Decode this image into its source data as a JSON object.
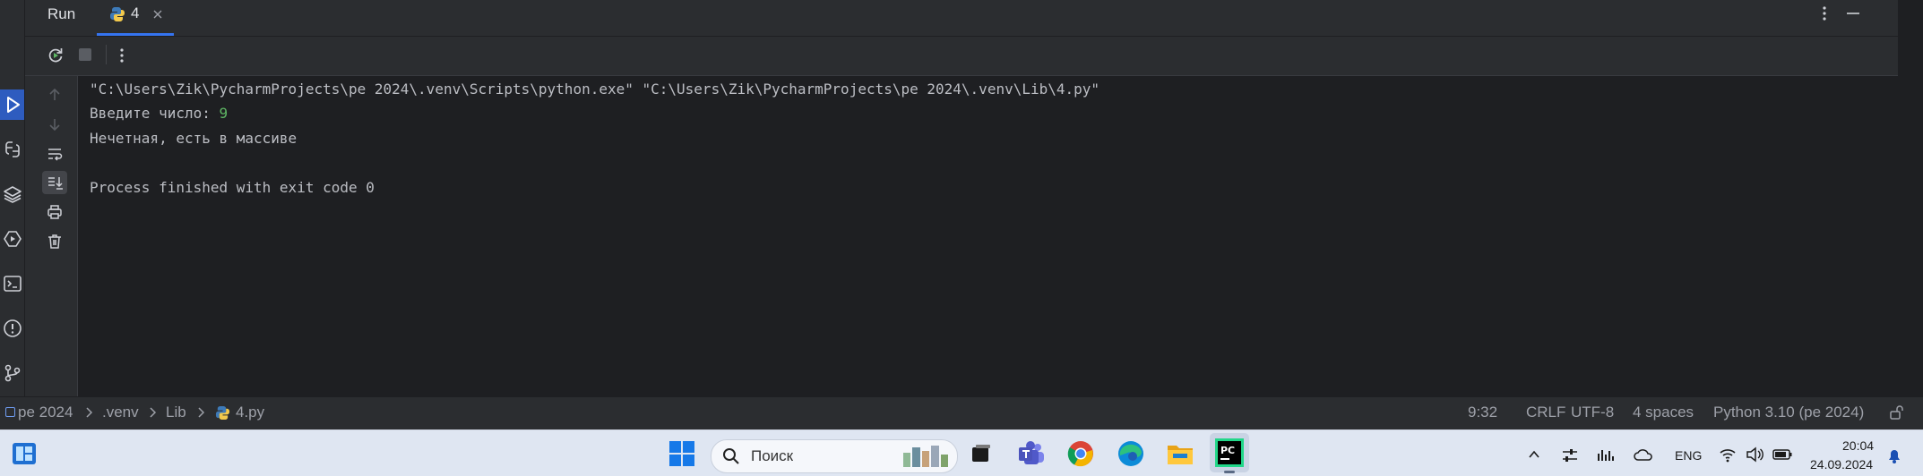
{
  "tool_window": {
    "title": "Run",
    "tab_label": "4"
  },
  "console": {
    "lines": [
      "\"C:\\Users\\Zik\\PycharmProjects\\pe 2024\\.venv\\Scripts\\python.exe\" \"C:\\Users\\Zik\\PycharmProjects\\pe 2024\\.venv\\Lib\\4.py\"",
      "Введите число: ",
      "Нечетная, есть в массиве",
      "",
      "Process finished with exit code 0"
    ],
    "user_input": "9",
    "colors": {
      "text": "#bcbec4",
      "input": "#5fb865"
    }
  },
  "breadcrumb": {
    "project": "pe 2024",
    "folder1": ".venv",
    "folder2": "Lib",
    "file": "4.py"
  },
  "status": {
    "position": "9:32",
    "line_separator": "CRLF",
    "encoding": "UTF-8",
    "indent": "4 spaces",
    "interpreter": "Python 3.10 (pe 2024)"
  },
  "taskbar": {
    "search_placeholder": "Поиск",
    "language": "ENG",
    "time": "20:04",
    "date": "24.09.2024"
  },
  "colors": {
    "accent": "#3574f0",
    "panel": "#2b2d30",
    "editor_bg": "#1e1f22",
    "pycharm_green": "#21d789"
  }
}
